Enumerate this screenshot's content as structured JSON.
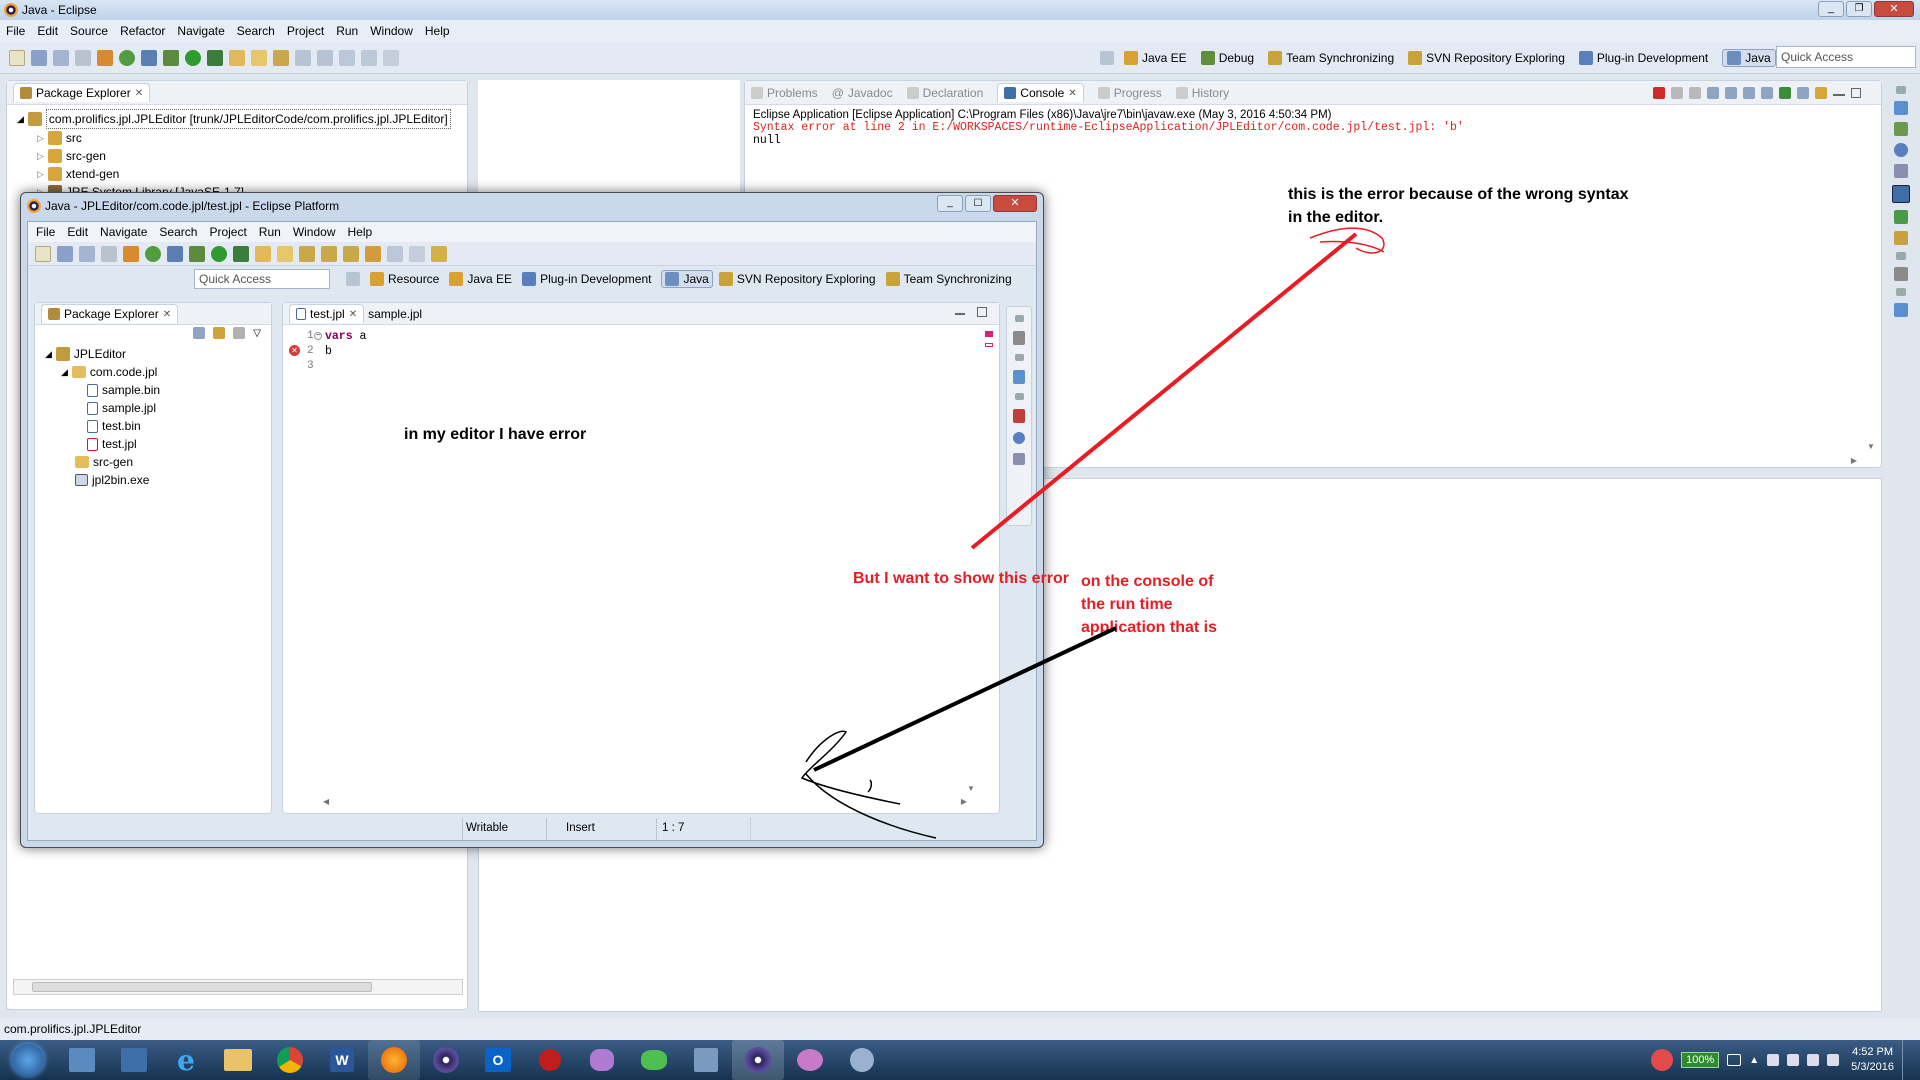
{
  "outer": {
    "title": "Java - Eclipse",
    "menu": [
      "File",
      "Edit",
      "Source",
      "Refactor",
      "Navigate",
      "Search",
      "Project",
      "Run",
      "Window",
      "Help"
    ],
    "perspectives": [
      "Java EE",
      "Debug",
      "Team Synchronizing",
      "SVN Repository Exploring",
      "Plug-in Development",
      "Java"
    ],
    "quick_access": "Quick Access",
    "package_explorer": {
      "tab": "Package Explorer",
      "project": "com.prolifics.jpl.JPLEditor [trunk/JPLEditorCode/com.prolifics.jpl.JPLEditor]",
      "items": [
        "src",
        "src-gen",
        "xtend-gen",
        "JRE System Library [JavaSE-1.7]"
      ]
    },
    "console": {
      "tabs": [
        "Problems",
        "Javadoc",
        "Declaration",
        "Console",
        "Progress",
        "History"
      ],
      "header": "Eclipse Application [Eclipse Application] C:\\Program Files (x86)\\Java\\jre7\\bin\\javaw.exe (May 3, 2016 4:50:34 PM)",
      "error_line": "Syntax error at line 2 in E:/WORKSPACES/runtime-EclipseApplication/JPLEditor/com.code.jpl/test.jpl: 'b'",
      "output_line": "null"
    },
    "status_text": "com.prolifics.jpl.JPLEditor"
  },
  "inner": {
    "title": "Java - JPLEditor/com.code.jpl/test.jpl - Eclipse Platform",
    "menu": [
      "File",
      "Edit",
      "Navigate",
      "Search",
      "Project",
      "Run",
      "Window",
      "Help"
    ],
    "quick_access": "Quick Access",
    "perspectives": [
      "Resource",
      "Java EE",
      "Plug-in Development",
      "Java",
      "SVN Repository Exploring",
      "Team Synchronizing"
    ],
    "package_explorer": {
      "tab": "Package Explorer",
      "project": "JPLEditor",
      "package": "com.code.jpl",
      "files": [
        "sample.bin",
        "sample.jpl",
        "test.bin",
        "test.jpl"
      ],
      "src_gen": "src-gen",
      "exe": "jpl2bin.exe"
    },
    "editor": {
      "tabs": [
        "test.jpl",
        "sample.jpl"
      ],
      "line_numbers": [
        "1",
        "2",
        "3"
      ],
      "code_line1_kw": "vars",
      "code_line1_rest": " a",
      "code_line2": "b"
    },
    "status": {
      "writable": "Writable",
      "insert": "Insert",
      "position": "1 : 7"
    }
  },
  "annotations": {
    "editor_note": "in my editor I have error",
    "console_note_1": "this is the error because of the wrong syntax",
    "console_note_2": "in the editor.",
    "want_1": "But I want to show this error",
    "want_2": "on the console of",
    "want_3": "the run time",
    "want_4": "application that is"
  },
  "taskbar": {
    "battery": "100%",
    "time": "4:52 PM",
    "date": "5/3/2016"
  },
  "colors": {
    "error_red": "#e02020",
    "annotation_red": "#e81c24",
    "keyword": "#7f0055"
  }
}
